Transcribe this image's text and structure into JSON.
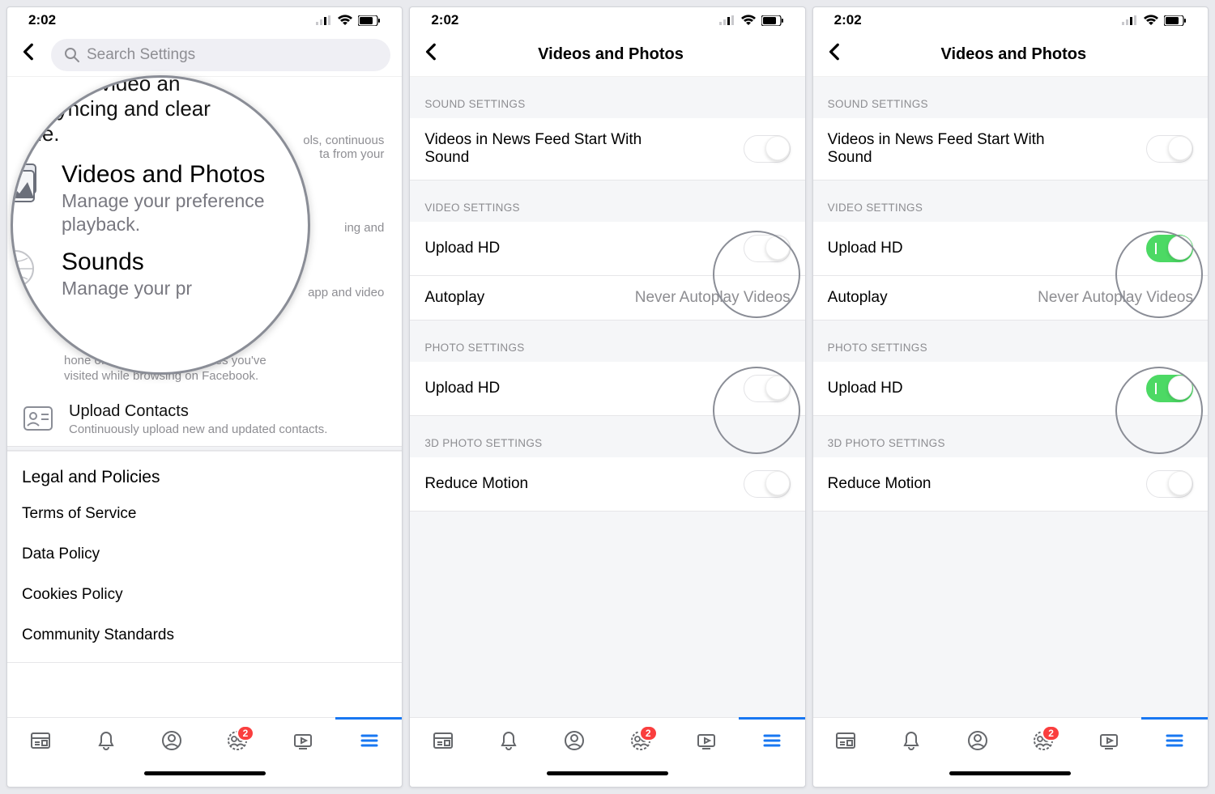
{
  "status": {
    "time": "2:02"
  },
  "screen1": {
    "search_placeholder": "Search Settings",
    "frag_top1": "age photo, video an",
    "frag_top2": "ntact syncing and clear",
    "frag_top3": "phone.",
    "frag_right1": "ols, continuous",
    "frag_right2": "ta from your",
    "mag_title": "Videos and Photos",
    "mag_sub1": "Manage your preference",
    "mag_sub2": "playback.",
    "mag_title2": "Sounds",
    "mag_sub3": "Manage your pr",
    "frag_mid1": "ing and",
    "frag_mid2": "app and video",
    "browser_sub1": "of the history of websites you've",
    "browser_sub1_pre": "hone",
    "browser_sub2": "visited while browsing on Facebook.",
    "upload_contacts": "Upload Contacts",
    "upload_contacts_sub": "Continuously upload new and updated contacts.",
    "legal": "Legal and Policies",
    "l1": "Terms of Service",
    "l2": "Data Policy",
    "l3": "Cookies Policy",
    "l4": "Community Standards"
  },
  "detail": {
    "title": "Videos and Photos",
    "sound_header": "SOUND SETTINGS",
    "sound_row": "Videos in News Feed Start With Sound",
    "video_header": "VIDEO SETTINGS",
    "video_upload_hd": "Upload HD",
    "autoplay": "Autoplay",
    "autoplay_value": "Never Autoplay Videos",
    "photo_header": "PHOTO SETTINGS",
    "photo_upload_hd": "Upload HD",
    "threed_header": "3D PHOTO SETTINGS",
    "reduce_motion": "Reduce Motion"
  },
  "tabs": {
    "badge": "2"
  }
}
